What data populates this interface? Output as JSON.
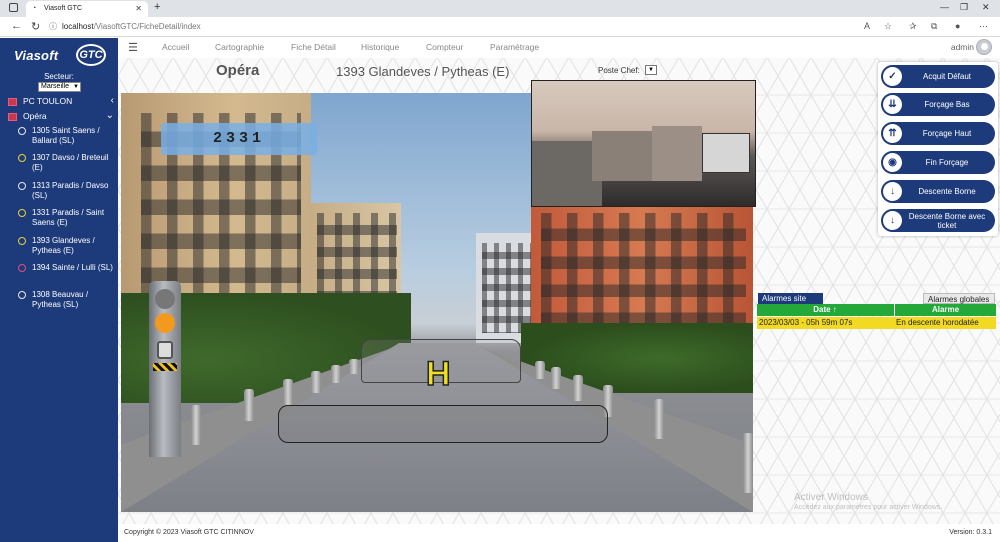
{
  "browser": {
    "tab_title": "Viasoft GTC",
    "url_host": "localhost",
    "url_path": "/ViasoftGTC/FicheDetail/index"
  },
  "sidebar": {
    "logo_text": "Viasoft",
    "logo_badge": "GTC",
    "secteur_label": "Secteur:",
    "secteur_value": "Marseille",
    "groups": [
      {
        "label": "PC TOULON",
        "chevron": "‹"
      },
      {
        "label": "Opéra",
        "chevron": "⌄"
      }
    ],
    "sites": [
      {
        "label": "1305 Saint Saens / Ballard (SL)",
        "color": "#e8e8e8"
      },
      {
        "label": "1307 Davso / Breteuil (E)",
        "color": "#e8d23a"
      },
      {
        "label": "1313 Paradis / Davso (SL)",
        "color": "#e8e8e8"
      },
      {
        "label": "1331 Paradis / Saint Saens (E)",
        "color": "#e8d23a"
      },
      {
        "label": "1393 Glandeves / Pytheas (E)",
        "color": "#e8d23a"
      },
      {
        "label": "1394 Sainte / Lulli (SL)",
        "color": "#e0507a"
      },
      {
        "label": "1308 Beauvau / Pytheas (SL)",
        "color": "#e8e8e8"
      }
    ]
  },
  "nav": {
    "links": [
      "Accueil",
      "Cartographie",
      "Fiche Détail",
      "Historique",
      "Compteur",
      "Paramétrage"
    ],
    "user": "admin"
  },
  "header": {
    "site_title": "Opéra",
    "site_subtitle": "1393 Glandeves / Pytheas (E)",
    "poste_label": "Poste Chef:"
  },
  "scene": {
    "code": "2331",
    "zone_letter": "H"
  },
  "actions": [
    {
      "label": "Acquit Défaut",
      "icon": "check-icon",
      "glyph": "✓"
    },
    {
      "label": "Forçage Bas",
      "icon": "double-arrow-down-icon",
      "glyph": "⇊"
    },
    {
      "label": "Forçage Haut",
      "icon": "double-arrow-up-icon",
      "glyph": "⇈"
    },
    {
      "label": "Fin Forçage",
      "icon": "stop-icon",
      "glyph": "◉"
    },
    {
      "label": "Descente Borne",
      "icon": "arrow-down-icon",
      "glyph": "↓"
    },
    {
      "label": "Descente Borne avec ticket",
      "icon": "arrow-down-ticket-icon",
      "glyph": "↓"
    }
  ],
  "alarms": {
    "tab_site": "Alarmes site",
    "tab_global": "Alarmes globales",
    "col_date": "Date ↑",
    "col_alarm": "Alarme",
    "rows": [
      {
        "date": "2023/03/03 - 05h 59m 07s",
        "alarm": "En descente horodatée"
      }
    ]
  },
  "watermark": {
    "line1": "Activer Windows",
    "line2": "Accédez aux paramètres pour activer Windows."
  },
  "footer": {
    "copyright": "Copyright © 2023 Viasoft GTC CITINNOV",
    "version": "Version: 0.3.1"
  },
  "colors": {
    "brand": "#1d3a7a",
    "alarm_header": "#24a83a",
    "alarm_row": "#f1da21"
  }
}
